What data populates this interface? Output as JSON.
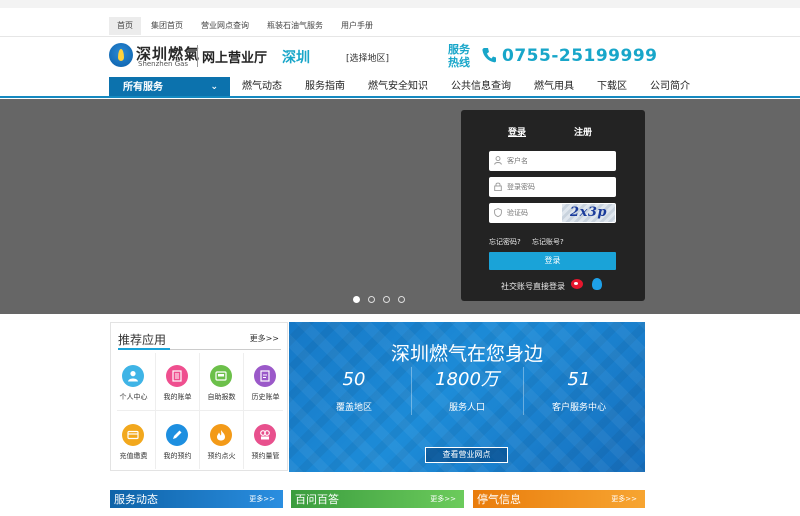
{
  "top_nav": {
    "items": [
      "首页",
      "集团首页",
      "营业网点查询",
      "瓶装石油气服务",
      "用户手册"
    ]
  },
  "header": {
    "logo_cn": "深圳燃氣",
    "logo_en": "Shenzhen Gas",
    "hall": "网上营业厅",
    "city": "深圳",
    "choose_region": "[选择地区]",
    "service_label": "服务热线",
    "phone": "0755-25199999"
  },
  "main_nav": {
    "all_services": "所有服务",
    "items": [
      "燃气动态",
      "服务指南",
      "燃气安全知识",
      "公共信息查询",
      "燃气用具",
      "下载区",
      "公司简介"
    ]
  },
  "carousel": {
    "slides": 4,
    "active": 1
  },
  "login": {
    "tab_login": "登录",
    "tab_register": "注册",
    "username_placeholder": "客户名",
    "password_placeholder": "登录密码",
    "captcha_placeholder": "验证码",
    "captcha_text": "2x3p",
    "forgot_password": "忘记密码?",
    "forgot_account": "忘记账号?",
    "submit": "登录",
    "social_login": "社交账号直接登录"
  },
  "recommended": {
    "title": "推荐应用",
    "more": "更多>>",
    "apps": [
      {
        "label": "个人中心",
        "icon": "person-icon",
        "color": "#3fb4e6"
      },
      {
        "label": "我的账单",
        "icon": "bill-icon",
        "color": "#ef4f8f"
      },
      {
        "label": "自助报数",
        "icon": "meter-icon",
        "color": "#6cc04a"
      },
      {
        "label": "历史账单",
        "icon": "history-icon",
        "color": "#9b59c9"
      },
      {
        "label": "充值缴费",
        "icon": "card-icon",
        "color": "#f2a81d"
      },
      {
        "label": "我的预约",
        "icon": "pen-icon",
        "color": "#1d8fe0"
      },
      {
        "label": "预约点火",
        "icon": "fire-icon",
        "color": "#f39a18"
      },
      {
        "label": "预约量管",
        "icon": "pipe-icon",
        "color": "#e8508d"
      }
    ]
  },
  "banner": {
    "headline": "深圳燃气在您身边",
    "stats": [
      {
        "value": "50",
        "caption": "覆盖地区"
      },
      {
        "value": "1800万",
        "caption": "服务人口"
      },
      {
        "value": "51",
        "caption": "客户服务中心"
      }
    ],
    "button": "查看营业网点"
  },
  "bottom_bars": [
    {
      "title": "服务动态",
      "more": "更多>>",
      "color": "#1677c2"
    },
    {
      "title": "百问百答",
      "more": "更多>>",
      "color": "#4cb04f"
    },
    {
      "title": "停气信息",
      "more": "更多>>",
      "color": "#f08a12"
    }
  ]
}
